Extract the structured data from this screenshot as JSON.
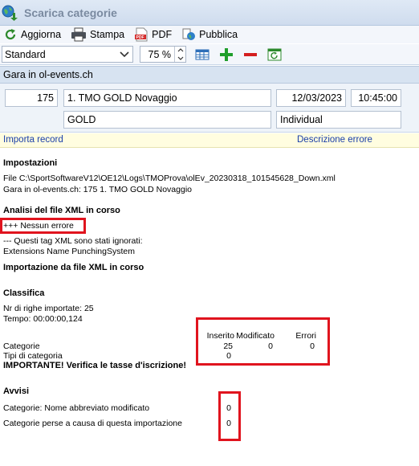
{
  "window": {
    "title": "Scarica categorie"
  },
  "toolbar": {
    "refresh_label": "Aggiorna",
    "print_label": "Stampa",
    "pdf_label": "PDF",
    "publish_label": "Pubblica"
  },
  "toolbar2": {
    "layout_value": "Standard",
    "zoom_value": "75 %"
  },
  "group": {
    "header": "Gara in ol-events.ch"
  },
  "form": {
    "event_number": "175",
    "event_name": "1. TMO GOLD Novaggio",
    "event_date": "12/03/2023",
    "event_time": "10:45:00",
    "event_level": "GOLD",
    "event_type": "Individual"
  },
  "strip": {
    "import_label": "Importa record",
    "error_desc_label": "Descrizione errore"
  },
  "report": {
    "settings_heading": "Impostazioni",
    "file_line": "File C:\\SportSoftwareV12\\OE12\\Logs\\TMOProva\\olEv_20230318_101545628_Down.xml",
    "event_line": "Gara in ol-events.ch: 175 1. TMO GOLD Novaggio",
    "xml_analysis_heading": "Analisi del file XML in corso",
    "no_error": "+++ Nessun errore",
    "ignored_tags": "--- Questi tag XML sono stati ignorati:",
    "ignored_list": "Extensions Name PunchingSystem",
    "import_heading": "Importazione da file XML in corso",
    "classifica_heading": "Classifica",
    "rows_imported": "Nr di righe importate: 25",
    "time": "Tempo: 00:00:00,124",
    "col_inserted": "Inserito",
    "col_modified": "Modificato",
    "col_errors": "Errori",
    "row_categories_label": "Categorie",
    "row_categories_inserted": "25",
    "row_categories_modified": "0",
    "row_categories_errors": "0",
    "row_types_label": "Tipi di categoria",
    "row_types_inserted": "0",
    "important": "IMPORTANTE! Verifica le tasse d'iscrizione!",
    "warnings_heading": "Avvisi",
    "warn1_label": "Categorie: Nome abbreviato modificato",
    "warn1_value": "0",
    "warn2_label": "Categorie perse a causa di questa importazione",
    "warn2_value": "0"
  }
}
